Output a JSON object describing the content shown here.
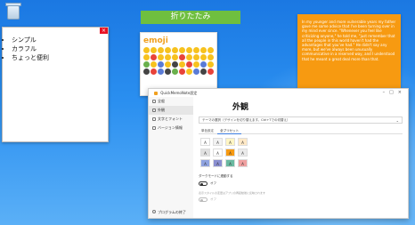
{
  "desktop": {
    "recycle_bin_label": "ごみ箱"
  },
  "sticky_white": {
    "items": [
      "シンプル",
      "カラフル",
      "ちょっと便利"
    ]
  },
  "title_banner": "折りたたみ",
  "sticky_orange": {
    "text": "In my younger and more vulnerable years my father gave me some advice that I've been turning over in my mind ever since. \"Whenever you feel like criticizing anyone,\" he told me, \"just remember that all the people in this world haven't had the advantages that you've had.\" He didn't say any more, but we've always been unusually communicative in a reserved way, and I understood that he meant a great deal more than that."
  },
  "emoji_window": {
    "title": "emoji"
  },
  "settings": {
    "window_title": "QuickMemoNote設定",
    "nav": [
      {
        "label": "全般",
        "icon": "home-icon"
      },
      {
        "label": "外観",
        "icon": "palette-icon"
      },
      {
        "label": "文字とフォント",
        "icon": "font-icon"
      },
      {
        "label": "バージョン情報",
        "icon": "info-icon"
      }
    ],
    "footer": "プログラムの終了",
    "page_title": "外観",
    "theme_select": "テーマの選択（デザインを切り替えます。Ctrl+Tでの切替え）",
    "subtabs": [
      "単色設定",
      "全プリセット"
    ],
    "swatch_letter": "A",
    "swatch_colors": [
      "#ffffff",
      "#f2f2f2",
      "#fff6c4",
      "#ffe9c7",
      "#e0e0e0",
      "#ffffff",
      "#f79a11",
      "#eaeaea",
      "#8fa3e0",
      "#8a8fd0",
      "#6ab9a0",
      "#f0a0a0"
    ],
    "option_label": "ダークモードに連動する",
    "toggle_off": "オフ",
    "hint": "表示スタイルの変更はアプリの再起動後に反映されます",
    "toggle2_off": "オフ"
  }
}
